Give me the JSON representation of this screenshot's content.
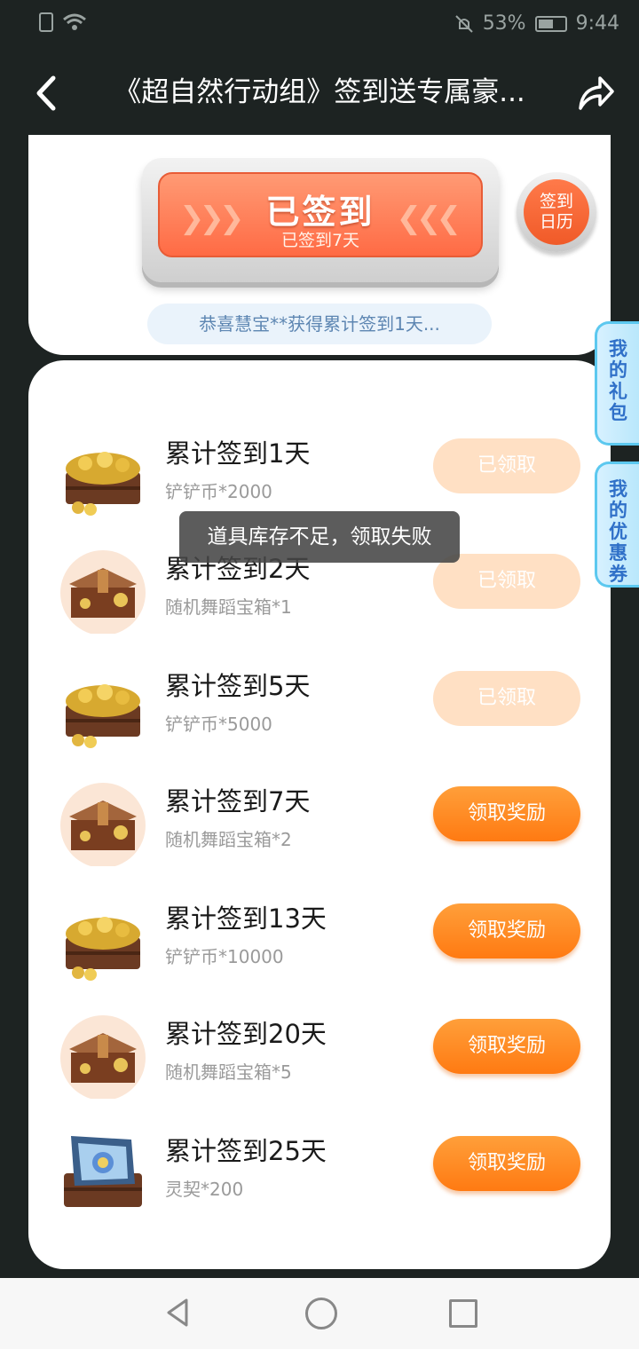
{
  "status": {
    "battery": "53%",
    "time": "9:44"
  },
  "nav": {
    "title": "《超自然行动组》签到送专属豪..."
  },
  "signin": {
    "title": "已签到",
    "subtitle": "已签到7天",
    "calendar_line1": "签到",
    "calendar_line2": "日历",
    "notice": "恭喜慧宝**获得累计签到1天..."
  },
  "side_tabs": [
    {
      "label": "我的礼包"
    },
    {
      "label": "我的优惠券"
    }
  ],
  "toast": "道具库存不足，领取失败",
  "rewards": [
    {
      "title": "累计签到1天",
      "item": "铲铲币*2000",
      "button": "已领取",
      "claimed": true,
      "icon": "coin-chest-icon"
    },
    {
      "title": "累计签到2天",
      "item": "随机舞蹈宝箱*1",
      "button": "已领取",
      "claimed": true,
      "icon": "dance-chest-icon"
    },
    {
      "title": "累计签到5天",
      "item": "铲铲币*5000",
      "button": "已领取",
      "claimed": true,
      "icon": "coin-chest-icon"
    },
    {
      "title": "累计签到7天",
      "item": "随机舞蹈宝箱*2",
      "button": "领取奖励",
      "claimed": false,
      "icon": "dance-chest-icon"
    },
    {
      "title": "累计签到13天",
      "item": "铲铲币*10000",
      "button": "领取奖励",
      "claimed": false,
      "icon": "coin-chest-icon"
    },
    {
      "title": "累计签到20天",
      "item": "随机舞蹈宝箱*5",
      "button": "领取奖励",
      "claimed": false,
      "icon": "dance-chest-icon"
    },
    {
      "title": "累计签到25天",
      "item": "灵契*200",
      "button": "领取奖励",
      "claimed": false,
      "icon": "spirit-contract-icon"
    }
  ]
}
